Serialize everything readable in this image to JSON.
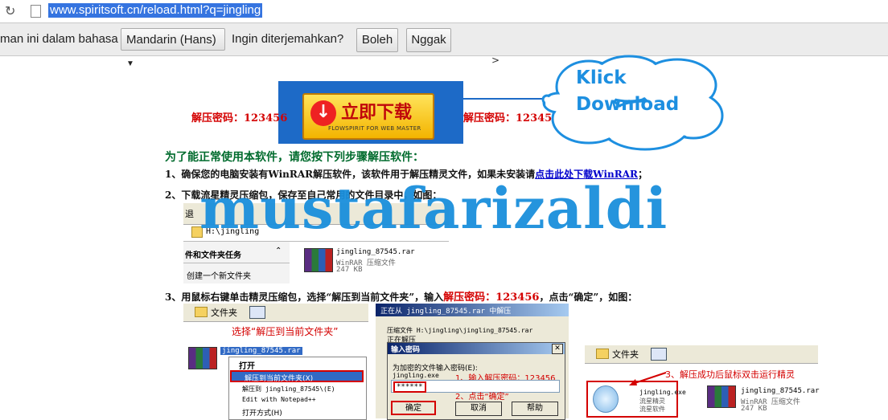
{
  "browser": {
    "url": "www.spiritsoft.cn/reload.html?q=jingling",
    "reload_icon": "reload-icon",
    "page_icon": "page-icon"
  },
  "translate_bar": {
    "prefix": "man ini dalam bahasa",
    "language": "Mandarin (Hans)",
    "question": "Ingin diterjemahkan?",
    "yes": "Boleh",
    "no": "Nggak"
  },
  "page": {
    "gt": ">",
    "password_left": "解压密码：123456",
    "password_right": "解压密码：123456",
    "download_button": "立即下载",
    "download_sub": "FLOWSPIRIT FOR WEB MASTER",
    "cloud_line1": "Klick",
    "cloud_line2": "Download",
    "heading": "为了能正常使用本软件，请您按下列步骤解压软件：",
    "step1_prefix": "1、确保您的电脑安装有WinRAR解压软件，该软件用于解压精灵文件，如果未安装请",
    "step1_link": "点击此处下载WinRAR",
    "step1_suffix": "；",
    "step2": "2、下载流星精灵压缩包，保存至自己常用的文件目录中，如图：",
    "step3_prefix": "3、用鼠标右键单击精灵压缩包，选择“解压到当前文件夹”，输入",
    "step3_pw": "解压密码：123456",
    "step3_suffix": "，点击“确定”，如图：",
    "watermark": "mustafarizaldi"
  },
  "shot1": {
    "back": "退",
    "address": "H:\\jingling",
    "panel_title": "件和文件夹任务",
    "panel_item": "创建一个新文件夹",
    "file_name": "jingling_87545.rar",
    "file_type": "WinRAR 压缩文件",
    "file_size": "247 KB"
  },
  "shot2": {
    "folder_label": "文件夹",
    "hint": "选择“解压到当前文件夹”",
    "file_name": "jingling_87545.rar",
    "menu": [
      "打开",
      "解压到当前文件夹(X)",
      "解压到 jingling_87545\\(E)",
      "Edit with Notepad++",
      "打开方式(H)"
    ]
  },
  "shot3": {
    "title": "正在从 jingling_87545.rar 中解压",
    "archive_line": "压缩文件 H:\\jingling\\jingling_87545.rar",
    "extracting": "正在解压",
    "dialog_title": "输入密码",
    "prompt": "为加密的文件输入密码(E):",
    "file": "jingling.exe",
    "hint1": "1、输入解压密码：123456",
    "password_value": "******",
    "hint2": "2、点击“确定”",
    "ok": "确定",
    "cancel": "取消",
    "help": "帮助"
  },
  "shot4": {
    "folder_label": "文件夹",
    "hint": "3、解压成功后鼠标双击运行精灵",
    "exe_name": "jingling.exe",
    "exe_desc1": "流星精灵",
    "exe_desc2": "流星软件",
    "file_name": "jingling_87545.rar",
    "file_type": "WinRAR 压缩文件",
    "file_size": "247 KB"
  }
}
